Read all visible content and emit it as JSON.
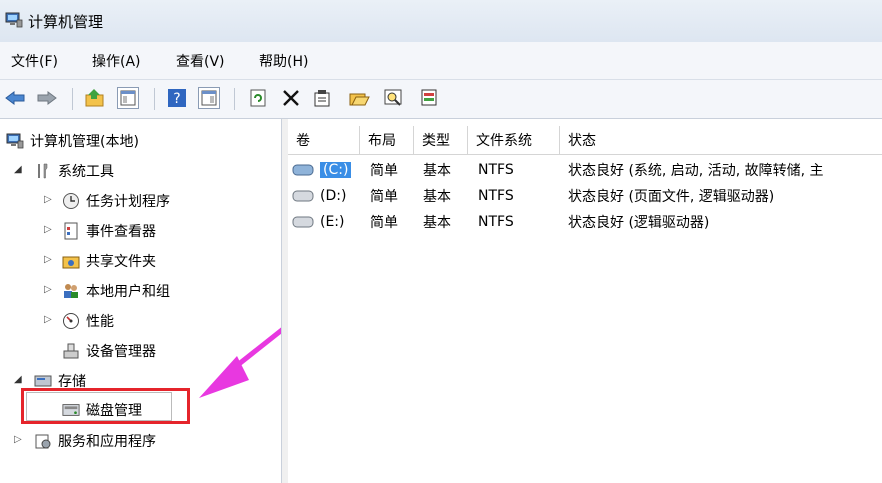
{
  "window": {
    "title": "计算机管理"
  },
  "menu": [
    "文件(F)",
    "操作(A)",
    "查看(V)",
    "帮助(H)"
  ],
  "toolbar": {
    "icons": [
      "back-arrow-icon",
      "forward-arrow-icon",
      "up-folder-icon",
      "show-hide-tree-icon",
      "help-icon",
      "action-pane-icon",
      "refresh-icon",
      "delete-icon",
      "properties-icon",
      "open-icon",
      "search-icon",
      "disk-settings-icon"
    ]
  },
  "tree": {
    "root": "计算机管理(本地)",
    "system_tools": "系统工具",
    "task_scheduler": "任务计划程序",
    "event_viewer": "事件查看器",
    "shared_folders": "共享文件夹",
    "local_users": "本地用户和组",
    "performance": "性能",
    "device_manager": "设备管理器",
    "storage": "存储",
    "disk_management": "磁盘管理",
    "services_apps": "服务和应用程序"
  },
  "columns": [
    "卷",
    "布局",
    "类型",
    "文件系统",
    "状态"
  ],
  "volumes": [
    {
      "name": "(C:)",
      "layout": "简单",
      "type": "基本",
      "fs": "NTFS",
      "status": "状态良好 (系统, 启动, 活动, 故障转储, 主"
    },
    {
      "name": "(D:)",
      "layout": "简单",
      "type": "基本",
      "fs": "NTFS",
      "status": "状态良好 (页面文件, 逻辑驱动器)"
    },
    {
      "name": "(E:)",
      "layout": "简单",
      "type": "基本",
      "fs": "NTFS",
      "status": "状态良好 (逻辑驱动器)"
    }
  ],
  "colors": {
    "selection": "#3a8ee6",
    "highlight_box": "#e5242b",
    "arrow": "#e838e0"
  }
}
